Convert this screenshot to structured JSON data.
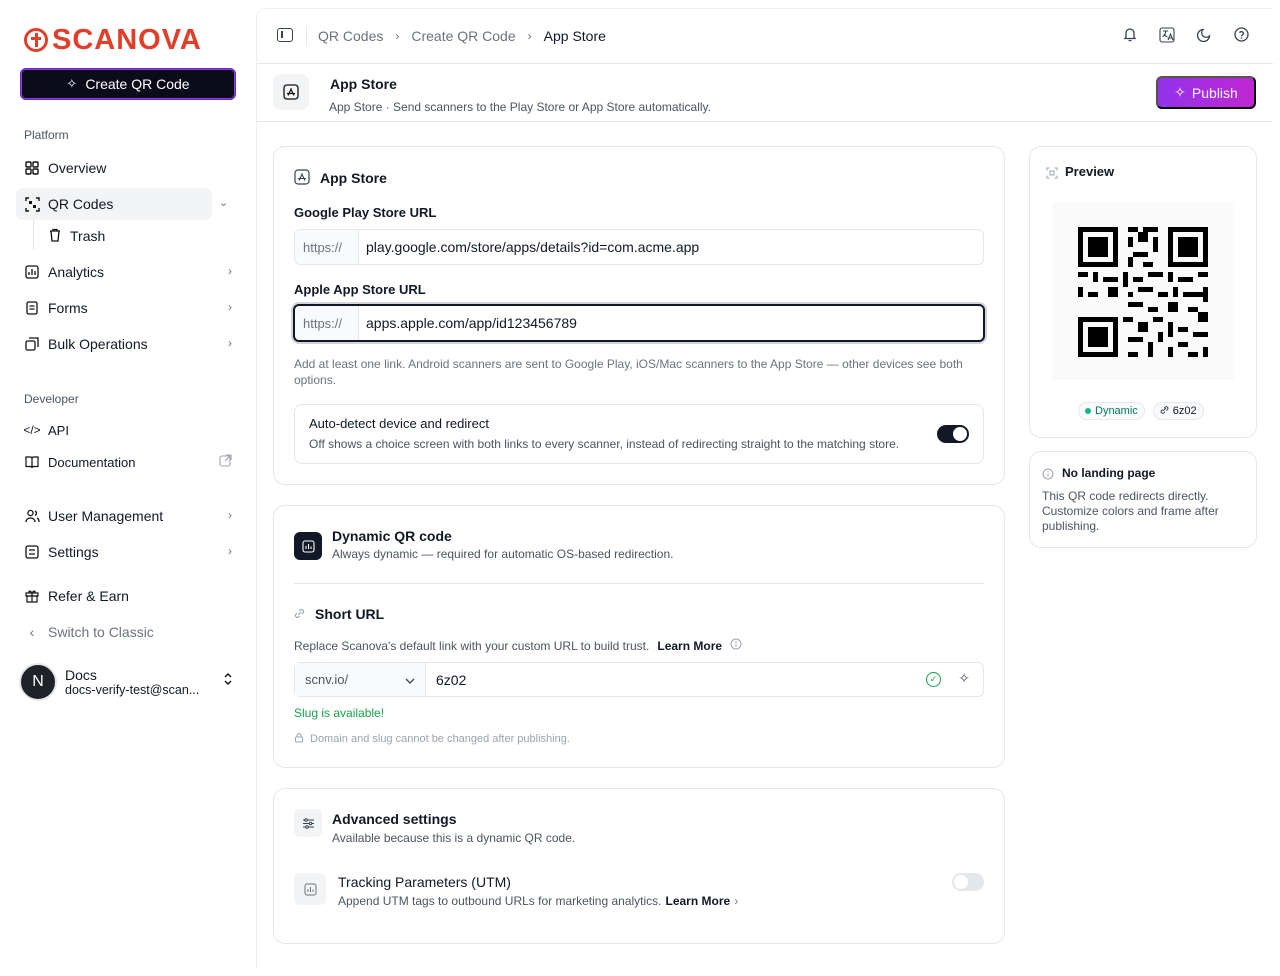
{
  "brand": {
    "name": "SCANOVA",
    "color": "#e0402a"
  },
  "sidebar": {
    "create_button": "Create QR Code",
    "platform_label": "Platform",
    "developer_label": "Developer",
    "items": {
      "overview": "Overview",
      "qr_codes": "QR Codes",
      "trash": "Trash",
      "analytics": "Analytics",
      "forms": "Forms",
      "bulk": "Bulk Operations",
      "api": "API",
      "docs": "Documentation",
      "users": "User Management",
      "settings": "Settings",
      "refer": "Refer & Earn",
      "classic": "Switch to Classic"
    },
    "user": {
      "initial": "N",
      "name": "Docs",
      "email": "docs-verify-test@scan..."
    }
  },
  "breadcrumb": [
    "QR Codes",
    "Create QR Code",
    "App Store"
  ],
  "header": {
    "title": "App Store",
    "subtitle": "App Store · Send scanners to the Play Store or App Store automatically.",
    "publish": "Publish"
  },
  "appstore_card": {
    "title": "App Store",
    "google_label": "Google Play Store URL",
    "google_prefix": "https://",
    "google_value": "play.google.com/store/apps/details?id=com.acme.app",
    "apple_label": "Apple App Store URL",
    "apple_prefix": "https://",
    "apple_value": "apps.apple.com/app/id123456789",
    "help": "Add at least one link. Android scanners are sent to Google Play, iOS/Mac scanners to the App Store — other devices see both options.",
    "autodetect_title": "Auto-detect device and redirect",
    "autodetect_desc": "Off shows a choice screen with both links to every scanner, instead of redirecting straight to the matching store.",
    "autodetect_on": true
  },
  "dynamic_card": {
    "title": "Dynamic QR code",
    "subtitle": "Always dynamic — required for automatic OS-based redirection.",
    "short_url_title": "Short URL",
    "short_url_desc": "Replace Scanova's default link with your custom URL to build trust.",
    "learn_more": "Learn More",
    "domain": "scnv.io/",
    "slug": "6z02",
    "slug_status": "Slug is available!",
    "lock_note": "Domain and slug cannot be changed after publishing."
  },
  "advanced_card": {
    "title": "Advanced settings",
    "subtitle": "Available because this is a dynamic QR code.",
    "utm_title": "Tracking Parameters (UTM)",
    "utm_desc": "Append UTM tags to outbound URLs for marketing analytics.",
    "learn_more": "Learn More",
    "utm_on": false
  },
  "preview": {
    "title": "Preview",
    "badge_dynamic": "Dynamic",
    "badge_slug": "6z02"
  },
  "landing": {
    "title": "No landing page",
    "desc": "This QR code redirects directly. Customize colors and frame after publishing."
  }
}
